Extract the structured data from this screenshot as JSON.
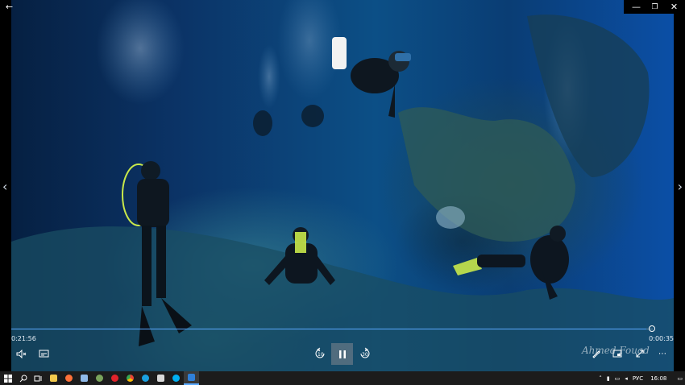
{
  "player": {
    "elapsed_time": "0:21:56",
    "remaining_time": "0:00:35",
    "progress_fraction": 0.99,
    "skip_back_label": "10",
    "skip_forward_label": "30",
    "watermark_text": "Ahmed Fouad"
  },
  "taskbar": {
    "language": "РУС",
    "clock": "16:08"
  },
  "colors": {
    "accent": "#5aa9ff",
    "water_deep": "#0a3366",
    "taskbar": "#1c1c1c"
  }
}
